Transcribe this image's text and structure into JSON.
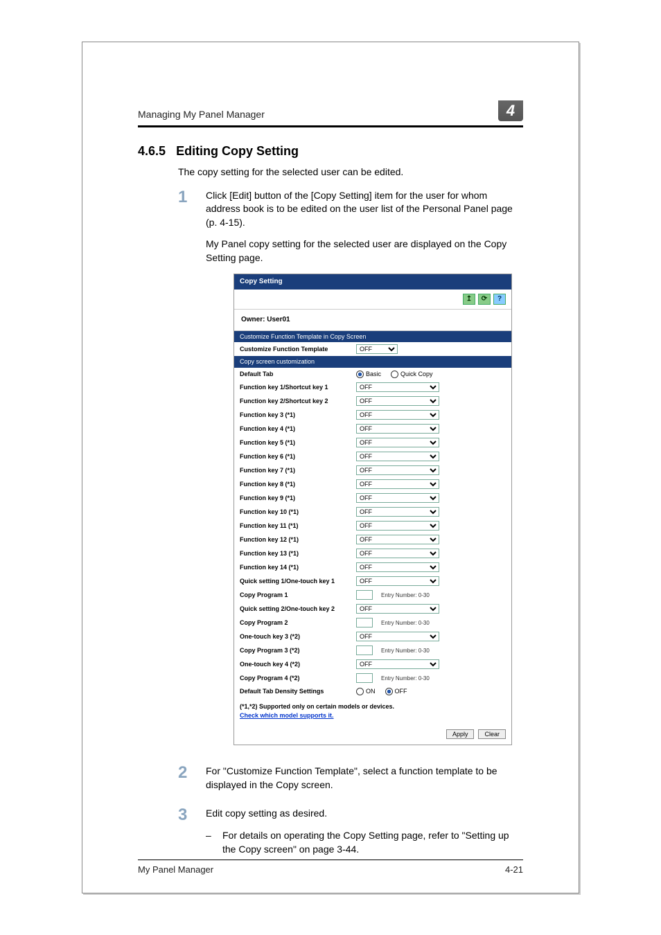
{
  "chapter_num": "4",
  "header_text": "Managing My Panel Manager",
  "section_number": "4.6.5",
  "section_title": "Editing Copy Setting",
  "intro_text": "The copy setting for the selected user can be edited.",
  "steps": {
    "s1": {
      "num": "1",
      "p1": "Click [Edit] button of the [Copy Setting] item for the user for whom address book is to be edited on the user list of the Personal Panel page (p. 4-15).",
      "p2": "My Panel copy setting for the selected user are displayed on the Copy Setting page."
    },
    "s2": {
      "num": "2",
      "text": "For \"Customize Function Template\", select a function template to be displayed in the Copy screen."
    },
    "s3": {
      "num": "3",
      "text": "Edit copy setting as desired.",
      "sub": "For details on operating the Copy Setting page, refer to \"Setting up the Copy screen\" on page 3-44."
    }
  },
  "footer": {
    "left": "My Panel Manager",
    "right": "4-21"
  },
  "screenshot": {
    "title": "Copy Setting",
    "owner": "Owner: User01",
    "toolbar": {
      "up_icon": "↥",
      "refresh_icon": "⟳",
      "help_icon": "?"
    },
    "band1": "Customize Function Template in Copy Screen",
    "cft_label": "Customize Function Template",
    "cft_value": "OFF",
    "band2": "Copy screen customization",
    "default_tab": {
      "label": "Default Tab",
      "opt1": "Basic",
      "opt2": "Quick Copy"
    },
    "func_keys": [
      {
        "label": "Function key 1/Shortcut key 1",
        "value": "OFF"
      },
      {
        "label": "Function key 2/Shortcut key 2",
        "value": "OFF"
      },
      {
        "label": "Function key 3 (*1)",
        "value": "OFF"
      },
      {
        "label": "Function key 4 (*1)",
        "value": "OFF"
      },
      {
        "label": "Function key 5 (*1)",
        "value": "OFF"
      },
      {
        "label": "Function key 6 (*1)",
        "value": "OFF"
      },
      {
        "label": "Function key 7 (*1)",
        "value": "OFF"
      },
      {
        "label": "Function key 8 (*1)",
        "value": "OFF"
      },
      {
        "label": "Function key 9 (*1)",
        "value": "OFF"
      },
      {
        "label": "Function key 10 (*1)",
        "value": "OFF"
      },
      {
        "label": "Function key 11 (*1)",
        "value": "OFF"
      },
      {
        "label": "Function key 12 (*1)",
        "value": "OFF"
      },
      {
        "label": "Function key 13 (*1)",
        "value": "OFF"
      },
      {
        "label": "Function key 14 (*1)",
        "value": "OFF"
      }
    ],
    "quick1": {
      "label": "Quick setting 1/One-touch key 1",
      "value": "OFF"
    },
    "prog1": {
      "label": "Copy Program 1",
      "hint": "Entry Number: 0-30"
    },
    "quick2": {
      "label": "Quick setting 2/One-touch key 2",
      "value": "OFF"
    },
    "prog2": {
      "label": "Copy Program 2",
      "hint": "Entry Number: 0-30"
    },
    "ot3": {
      "label": "One-touch key 3 (*2)",
      "value": "OFF"
    },
    "prog3": {
      "label": "Copy Program 3 (*2)",
      "hint": "Entry Number: 0-30"
    },
    "ot4": {
      "label": "One-touch key 4 (*2)",
      "value": "OFF"
    },
    "prog4": {
      "label": "Copy Program 4 (*2)",
      "hint": "Entry Number: 0-30"
    },
    "density": {
      "label": "Default Tab Density Settings",
      "on": "ON",
      "off": "OFF"
    },
    "footnote": "(*1,*2) Supported only on certain models or devices.",
    "footnote_link": "Check which model supports it.",
    "apply": "Apply",
    "clear": "Clear"
  }
}
